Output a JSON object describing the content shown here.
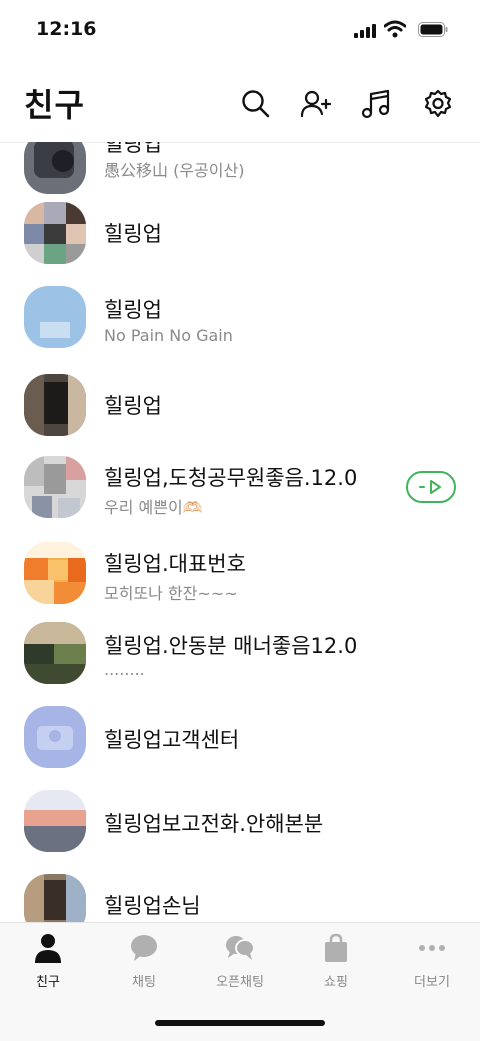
{
  "status_bar": {
    "time": "12:16"
  },
  "header": {
    "title": "친구",
    "icons": [
      "search-icon",
      "add-friend-icon",
      "music-icon",
      "settings-icon"
    ]
  },
  "friends": [
    {
      "name": "힐링업",
      "status": "愚公移山 (우공이산)"
    },
    {
      "name": "힐링업",
      "status": ""
    },
    {
      "name": "힐링업",
      "status": "No Pain No Gain"
    },
    {
      "name": "힐링업",
      "status": ""
    },
    {
      "name": "힐링업,도청공무원좋음.12.0",
      "status": "우리 예쁜이🫶🏻",
      "has_music": true
    },
    {
      "name": "힐링업.대표번호",
      "status": "모히또나 한잔~~~"
    },
    {
      "name": "힐링업.안동분 매너좋음12.0",
      "status": "........"
    },
    {
      "name": "힐링업고객센터",
      "status": ""
    },
    {
      "name": "힐링업보고전화.안해본분",
      "status": ""
    },
    {
      "name": "힐링업손님",
      "status": ""
    }
  ],
  "tabs": [
    {
      "label": "친구",
      "icon": "person-icon",
      "active": true
    },
    {
      "label": "채팅",
      "icon": "chat-bubble-icon"
    },
    {
      "label": "오픈채팅",
      "icon": "open-chat-icon"
    },
    {
      "label": "쇼핑",
      "icon": "shopping-bag-icon"
    },
    {
      "label": "더보기",
      "icon": "more-dots-icon"
    }
  ],
  "colors": {
    "music_accent": "#3fb55b",
    "tab_bg": "#f8f8f8"
  }
}
